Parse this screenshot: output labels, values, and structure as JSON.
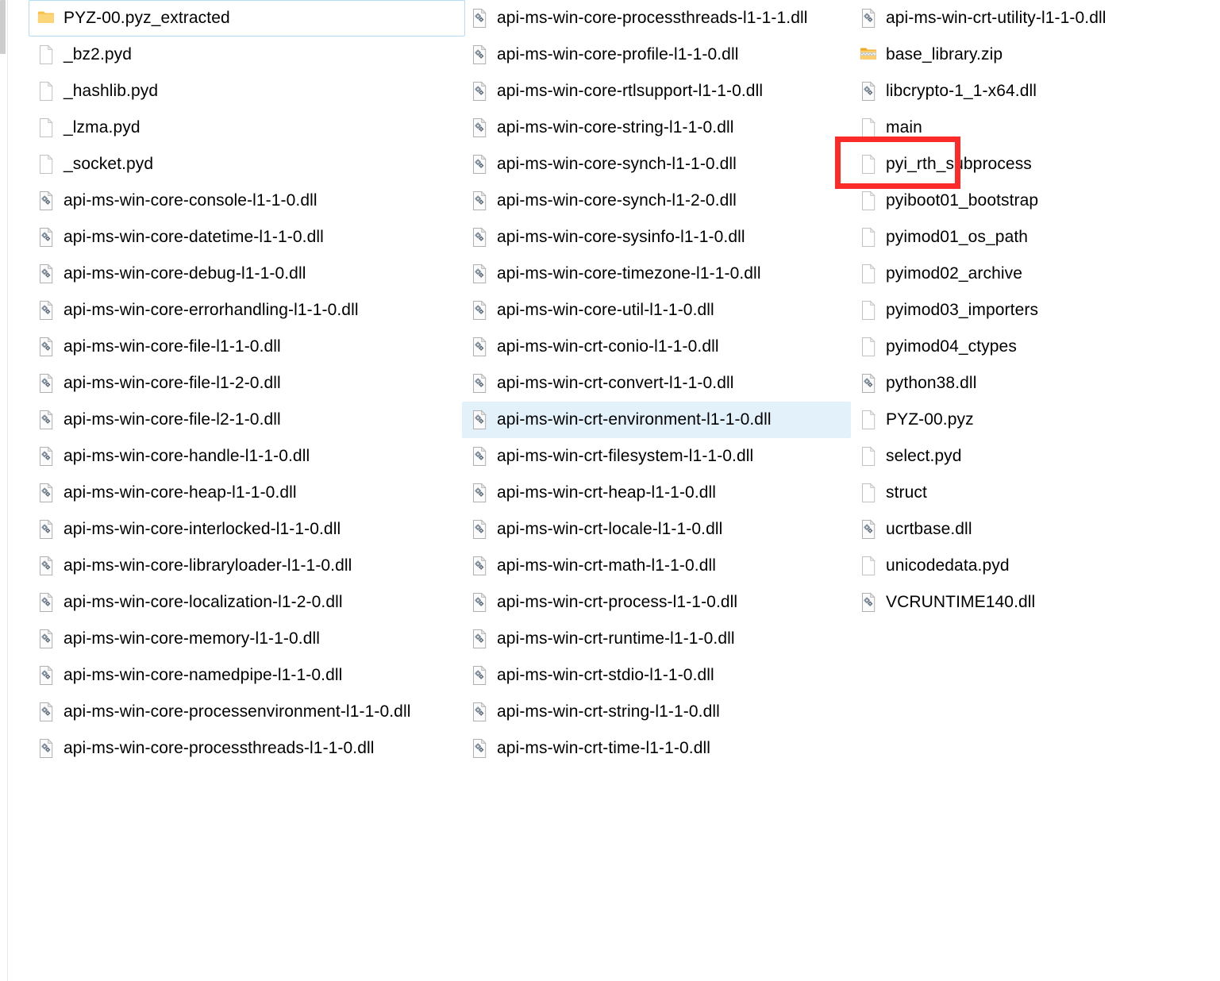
{
  "window": {
    "view_mode": "list",
    "accent_selection_color": "#e3f1fb",
    "focus_border_color": "#b5dcf5",
    "annotation_color": "#fa2b28"
  },
  "annotation": {
    "target_label": "main",
    "shape": "rectangle"
  },
  "columns": [
    {
      "index": 0,
      "items": [
        {
          "label": "PYZ-00.pyz_extracted",
          "icon": "folder-icon",
          "state": "focused"
        },
        {
          "label": "_bz2.pyd",
          "icon": "file-icon",
          "state": "normal"
        },
        {
          "label": "_hashlib.pyd",
          "icon": "file-icon",
          "state": "normal"
        },
        {
          "label": "_lzma.pyd",
          "icon": "file-icon",
          "state": "normal"
        },
        {
          "label": "_socket.pyd",
          "icon": "file-icon",
          "state": "normal"
        },
        {
          "label": "api-ms-win-core-console-l1-1-0.dll",
          "icon": "dll-icon",
          "state": "normal"
        },
        {
          "label": "api-ms-win-core-datetime-l1-1-0.dll",
          "icon": "dll-icon",
          "state": "normal"
        },
        {
          "label": "api-ms-win-core-debug-l1-1-0.dll",
          "icon": "dll-icon",
          "state": "normal"
        },
        {
          "label": "api-ms-win-core-errorhandling-l1-1-0.dll",
          "icon": "dll-icon",
          "state": "normal"
        },
        {
          "label": "api-ms-win-core-file-l1-1-0.dll",
          "icon": "dll-icon",
          "state": "normal"
        },
        {
          "label": "api-ms-win-core-file-l1-2-0.dll",
          "icon": "dll-icon",
          "state": "normal"
        },
        {
          "label": "api-ms-win-core-file-l2-1-0.dll",
          "icon": "dll-icon",
          "state": "normal"
        },
        {
          "label": "api-ms-win-core-handle-l1-1-0.dll",
          "icon": "dll-icon",
          "state": "normal"
        },
        {
          "label": "api-ms-win-core-heap-l1-1-0.dll",
          "icon": "dll-icon",
          "state": "normal"
        },
        {
          "label": "api-ms-win-core-interlocked-l1-1-0.dll",
          "icon": "dll-icon",
          "state": "normal"
        },
        {
          "label": "api-ms-win-core-libraryloader-l1-1-0.dll",
          "icon": "dll-icon",
          "state": "normal"
        },
        {
          "label": "api-ms-win-core-localization-l1-2-0.dll",
          "icon": "dll-icon",
          "state": "normal"
        },
        {
          "label": "api-ms-win-core-memory-l1-1-0.dll",
          "icon": "dll-icon",
          "state": "normal"
        },
        {
          "label": "api-ms-win-core-namedpipe-l1-1-0.dll",
          "icon": "dll-icon",
          "state": "normal"
        },
        {
          "label": "api-ms-win-core-processenvironment-l1-1-0.dll",
          "icon": "dll-icon",
          "state": "normal"
        },
        {
          "label": "api-ms-win-core-processthreads-l1-1-0.dll",
          "icon": "dll-icon",
          "state": "normal"
        }
      ]
    },
    {
      "index": 1,
      "items": [
        {
          "label": "api-ms-win-core-processthreads-l1-1-1.dll",
          "icon": "dll-icon",
          "state": "normal"
        },
        {
          "label": "api-ms-win-core-profile-l1-1-0.dll",
          "icon": "dll-icon",
          "state": "normal"
        },
        {
          "label": "api-ms-win-core-rtlsupport-l1-1-0.dll",
          "icon": "dll-icon",
          "state": "normal"
        },
        {
          "label": "api-ms-win-core-string-l1-1-0.dll",
          "icon": "dll-icon",
          "state": "normal"
        },
        {
          "label": "api-ms-win-core-synch-l1-1-0.dll",
          "icon": "dll-icon",
          "state": "normal"
        },
        {
          "label": "api-ms-win-core-synch-l1-2-0.dll",
          "icon": "dll-icon",
          "state": "normal"
        },
        {
          "label": "api-ms-win-core-sysinfo-l1-1-0.dll",
          "icon": "dll-icon",
          "state": "normal"
        },
        {
          "label": "api-ms-win-core-timezone-l1-1-0.dll",
          "icon": "dll-icon",
          "state": "normal"
        },
        {
          "label": "api-ms-win-core-util-l1-1-0.dll",
          "icon": "dll-icon",
          "state": "normal"
        },
        {
          "label": "api-ms-win-crt-conio-l1-1-0.dll",
          "icon": "dll-icon",
          "state": "normal"
        },
        {
          "label": "api-ms-win-crt-convert-l1-1-0.dll",
          "icon": "dll-icon",
          "state": "normal"
        },
        {
          "label": "api-ms-win-crt-environment-l1-1-0.dll",
          "icon": "dll-icon",
          "state": "selected"
        },
        {
          "label": "api-ms-win-crt-filesystem-l1-1-0.dll",
          "icon": "dll-icon",
          "state": "normal"
        },
        {
          "label": "api-ms-win-crt-heap-l1-1-0.dll",
          "icon": "dll-icon",
          "state": "normal"
        },
        {
          "label": "api-ms-win-crt-locale-l1-1-0.dll",
          "icon": "dll-icon",
          "state": "normal"
        },
        {
          "label": "api-ms-win-crt-math-l1-1-0.dll",
          "icon": "dll-icon",
          "state": "normal"
        },
        {
          "label": "api-ms-win-crt-process-l1-1-0.dll",
          "icon": "dll-icon",
          "state": "normal"
        },
        {
          "label": "api-ms-win-crt-runtime-l1-1-0.dll",
          "icon": "dll-icon",
          "state": "normal"
        },
        {
          "label": "api-ms-win-crt-stdio-l1-1-0.dll",
          "icon": "dll-icon",
          "state": "normal"
        },
        {
          "label": "api-ms-win-crt-string-l1-1-0.dll",
          "icon": "dll-icon",
          "state": "normal"
        },
        {
          "label": "api-ms-win-crt-time-l1-1-0.dll",
          "icon": "dll-icon",
          "state": "normal"
        }
      ]
    },
    {
      "index": 2,
      "items": [
        {
          "label": "api-ms-win-crt-utility-l1-1-0.dll",
          "icon": "dll-icon",
          "state": "normal"
        },
        {
          "label": "base_library.zip",
          "icon": "zip-folder-icon",
          "state": "normal"
        },
        {
          "label": "libcrypto-1_1-x64.dll",
          "icon": "dll-icon",
          "state": "normal"
        },
        {
          "label": "main",
          "icon": "file-icon",
          "state": "annotated"
        },
        {
          "label": "pyi_rth_subprocess",
          "icon": "file-icon",
          "state": "normal"
        },
        {
          "label": "pyiboot01_bootstrap",
          "icon": "file-icon",
          "state": "normal"
        },
        {
          "label": "pyimod01_os_path",
          "icon": "file-icon",
          "state": "normal"
        },
        {
          "label": "pyimod02_archive",
          "icon": "file-icon",
          "state": "normal"
        },
        {
          "label": "pyimod03_importers",
          "icon": "file-icon",
          "state": "normal"
        },
        {
          "label": "pyimod04_ctypes",
          "icon": "file-icon",
          "state": "normal"
        },
        {
          "label": "python38.dll",
          "icon": "dll-icon",
          "state": "normal"
        },
        {
          "label": "PYZ-00.pyz",
          "icon": "file-icon",
          "state": "normal"
        },
        {
          "label": "select.pyd",
          "icon": "file-icon",
          "state": "normal"
        },
        {
          "label": "struct",
          "icon": "file-icon",
          "state": "normal"
        },
        {
          "label": "ucrtbase.dll",
          "icon": "dll-icon",
          "state": "normal"
        },
        {
          "label": "unicodedata.pyd",
          "icon": "file-icon",
          "state": "normal"
        },
        {
          "label": "VCRUNTIME140.dll",
          "icon": "dll-icon",
          "state": "normal"
        }
      ]
    }
  ]
}
